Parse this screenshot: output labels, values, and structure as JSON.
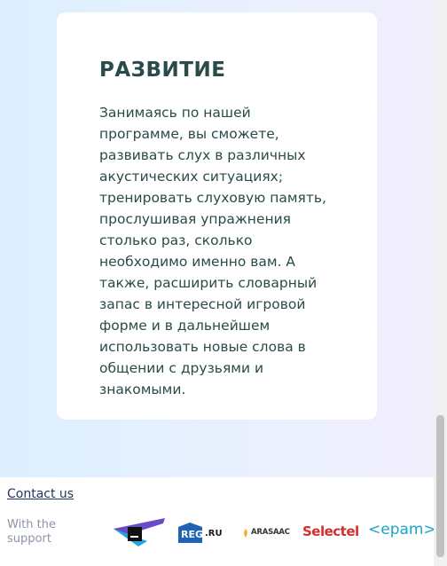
{
  "card": {
    "title": "РАЗВИТИЕ",
    "text": "Занимаясь по нашей программе, вы сможете, развивать слух в различных акустических ситуациях; тренировать слуховую память, прослушивая упражнения столько раз, сколько необходимо именно вам. А также, расширить словарный запас в интересной игровой форме и в дальнейшем использовать новые слова в общении с друзьями и знакомыми."
  },
  "footer": {
    "contact_label": "Contact us",
    "support_label": "With the support",
    "sponsors": {
      "regru": {
        "main": "REG",
        "suffix": ".RU"
      },
      "arasaac": "ARASAAC",
      "selectel": "Selectel",
      "epam": "<epam>"
    }
  },
  "colors": {
    "heading": "#2b4a4a",
    "link": "#24355f",
    "muted": "#8b95a8",
    "regru_blue": "#1e63b6",
    "selectel_red": "#d62e2e",
    "epam_blue": "#1da1c9"
  }
}
